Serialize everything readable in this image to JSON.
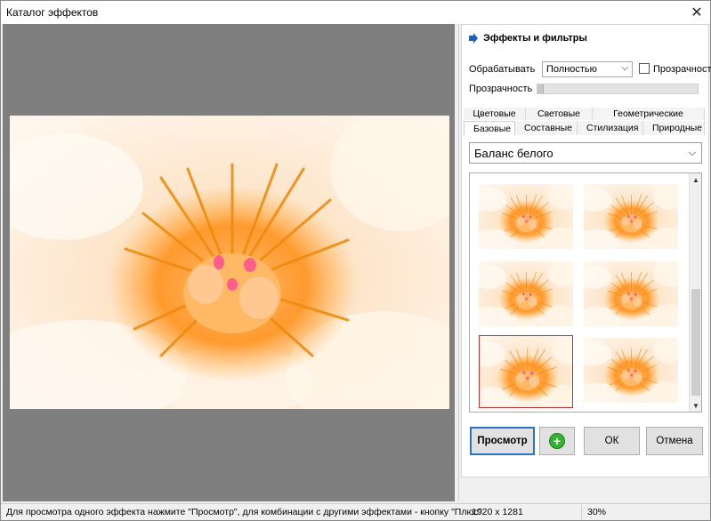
{
  "window": {
    "title": "Каталог эффектов",
    "close_glyph": "✕"
  },
  "panel": {
    "header_label": "Эффекты и фильтры",
    "process_label": "Обрабатывать",
    "process_value": "Полностью",
    "transparency_check_label": "Прозрачность",
    "transparency_checked": false,
    "transparency_label": "Прозрачность",
    "transparency_level": 0,
    "tabs_top": [
      "Цветовые",
      "Световые",
      "Геометрические"
    ],
    "tabs_bottom": [
      "Базовые",
      "Составные",
      "Стилизация",
      "Природные"
    ],
    "active_tab": "Базовые",
    "effect_value": "Баланс белого",
    "thumbnail_count": 6,
    "selected_thumbnail": 4,
    "scroll_up_glyph": "▲",
    "scroll_down_glyph": "▼"
  },
  "buttons": {
    "preview": "Просмотр",
    "plus": "+",
    "ok": "ОК",
    "cancel": "Отмена"
  },
  "status": {
    "hint": "Для просмотра одного эффекта нажмите \"Просмотр\", для комбинации с другими эффектами - кнопку \"Плюс\"",
    "dimensions": "1920 x 1281",
    "zoom": "30%"
  },
  "colors": {
    "accent": "#2a74c8",
    "selection": "#c03030",
    "plus_green": "#34b233",
    "workspace": "#7f7f7f"
  },
  "icons": {
    "header": "right-arrow-icon",
    "dropdown": "chevron-down-icon",
    "close": "close-icon",
    "plus": "plus-circle-icon"
  }
}
